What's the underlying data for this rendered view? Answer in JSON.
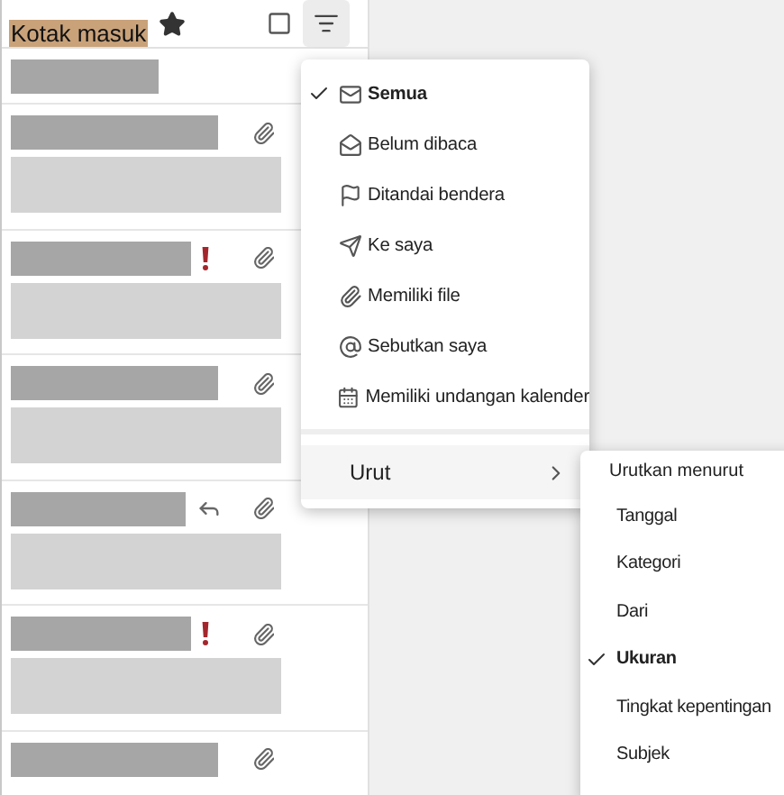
{
  "mail_list": {
    "heading": "Kotak masuk",
    "favorite": true,
    "rows": [
      {
        "kind": "header"
      },
      {
        "kind": "message",
        "important": false,
        "replied": false,
        "attachment": true
      },
      {
        "kind": "message",
        "important": true,
        "replied": false,
        "attachment": true
      },
      {
        "kind": "message",
        "important": false,
        "replied": false,
        "attachment": true
      },
      {
        "kind": "message",
        "important": false,
        "replied": true,
        "attachment": true
      },
      {
        "kind": "message",
        "important": true,
        "replied": false,
        "attachment": true
      },
      {
        "kind": "partial",
        "important": false,
        "replied": false,
        "attachment": true
      }
    ]
  },
  "filter_menu": {
    "items": [
      {
        "kind": "mail",
        "label": "Semua",
        "selected": true
      },
      {
        "kind": "unread",
        "label": "Belum dibaca",
        "selected": false
      },
      {
        "kind": "flag",
        "label": "Ditandai bendera",
        "selected": false
      },
      {
        "kind": "send",
        "label": "Ke saya",
        "selected": false
      },
      {
        "kind": "clip",
        "label": "Memiliki file",
        "selected": false
      },
      {
        "kind": "at",
        "label": "Sebutkan saya",
        "selected": false
      },
      {
        "kind": "calendar",
        "label": "Memiliki undangan kalender",
        "selected": false
      }
    ],
    "sort": {
      "label": "Urut",
      "expanded": true
    }
  },
  "sort_menu": {
    "heading": "Urutkan menurut",
    "items": [
      {
        "label": "Tanggal",
        "selected": false
      },
      {
        "label": "Kategori",
        "selected": false
      },
      {
        "label": "Dari",
        "selected": false
      },
      {
        "label": "Ukuran",
        "selected": true
      },
      {
        "label": "Tingkat kepentingan",
        "selected": false
      },
      {
        "label": "Subjek",
        "selected": false
      }
    ]
  }
}
